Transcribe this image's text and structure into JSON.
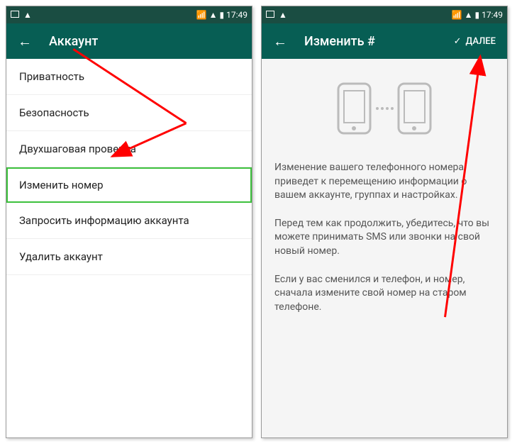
{
  "status": {
    "time": "17:49"
  },
  "screen1": {
    "title": "Аккаунт",
    "items": [
      "Приватность",
      "Безопасность",
      "Двухшаговая проверка",
      "Изменить номер",
      "Запросить информацию аккаунта",
      "Удалить аккаунт"
    ]
  },
  "screen2": {
    "title": "Изменить #",
    "action": "ДАЛЕЕ",
    "para1": "Изменение вашего телефонного номера приведет к перемещению информации о вашем аккаунте, группах и настройках.",
    "para2": "Перед тем как продолжить, убедитесь, что вы можете принимать SMS или звонки на свой новый номер.",
    "para3": "Если у вас сменился и телефон, и номер, сначала измените свой номер на старом телефоне."
  }
}
